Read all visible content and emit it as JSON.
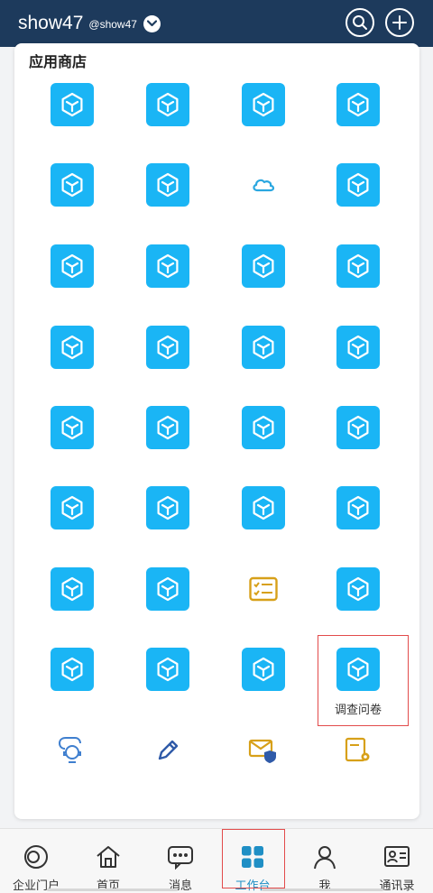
{
  "header": {
    "brand": "show47",
    "handle": "@show47",
    "dropdown_icon": "chevron-down-icon",
    "search_icon": "search-icon",
    "add_icon": "plus-icon",
    "background_color": "#1d3a5c"
  },
  "app_store": {
    "title": "应用商店",
    "accent_color": "#1ab5f5",
    "apps": [
      {
        "label": "",
        "icon": "cube-icon"
      },
      {
        "label": "",
        "icon": "cube-icon"
      },
      {
        "label": "",
        "icon": "cube-icon"
      },
      {
        "label": "",
        "icon": "cube-icon"
      },
      {
        "label": "",
        "icon": "cube-icon"
      },
      {
        "label": "",
        "icon": "cube-icon"
      },
      {
        "label": "",
        "icon": "cloud-icon"
      },
      {
        "label": "",
        "icon": "cube-icon"
      },
      {
        "label": "",
        "icon": "cube-icon"
      },
      {
        "label": "",
        "icon": "cube-icon"
      },
      {
        "label": "",
        "icon": "cube-icon"
      },
      {
        "label": "",
        "icon": "cube-icon"
      },
      {
        "label": "",
        "icon": "cube-icon"
      },
      {
        "label": "",
        "icon": "cube-icon"
      },
      {
        "label": "",
        "icon": "cube-icon"
      },
      {
        "label": "",
        "icon": "cube-icon"
      },
      {
        "label": "",
        "icon": "cube-icon"
      },
      {
        "label": "",
        "icon": "cube-icon"
      },
      {
        "label": "",
        "icon": "cube-icon"
      },
      {
        "label": "",
        "icon": "cube-icon"
      },
      {
        "label": "",
        "icon": "cube-icon"
      },
      {
        "label": "",
        "icon": "cube-icon"
      },
      {
        "label": "",
        "icon": "cube-icon"
      },
      {
        "label": "",
        "icon": "cube-icon"
      },
      {
        "label": "",
        "icon": "cube-icon"
      },
      {
        "label": "",
        "icon": "cube-icon"
      },
      {
        "label": "",
        "icon": "checklist-icon"
      },
      {
        "label": "",
        "icon": "cube-icon"
      },
      {
        "label": "",
        "icon": "cube-icon"
      },
      {
        "label": "",
        "icon": "cube-icon"
      },
      {
        "label": "",
        "icon": "cube-icon"
      },
      {
        "label": "调查问卷",
        "icon": "cube-icon"
      },
      {
        "label": "",
        "icon": "support-chat-icon"
      },
      {
        "label": "",
        "icon": "pencil-icon"
      },
      {
        "label": "",
        "icon": "mail-shield-icon"
      },
      {
        "label": "",
        "icon": "doc-settings-icon"
      }
    ]
  },
  "tabbar": {
    "active_color": "#1f8fc5",
    "tabs": [
      {
        "label": "企业门户",
        "icon": "portal-icon"
      },
      {
        "label": "首页",
        "icon": "home-icon"
      },
      {
        "label": "消息",
        "icon": "message-icon"
      },
      {
        "label": "工作台",
        "icon": "workbench-grid-icon"
      },
      {
        "label": "我",
        "icon": "person-icon"
      },
      {
        "label": "通讯录",
        "icon": "contacts-icon"
      }
    ],
    "active_index": 3
  }
}
